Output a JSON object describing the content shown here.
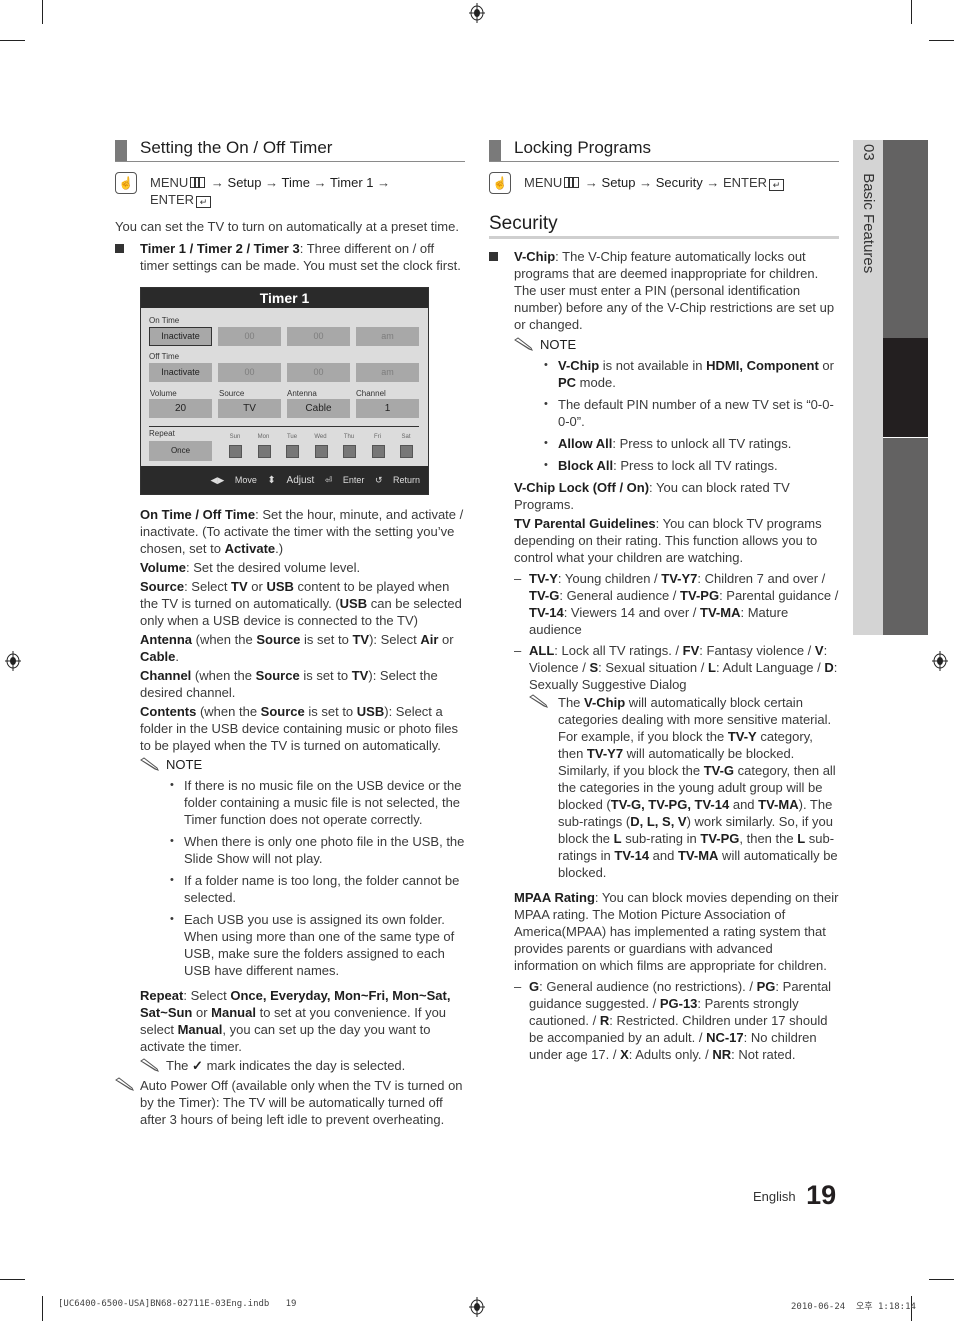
{
  "left": {
    "section_title": "Setting the On / Off Timer",
    "menu_path": {
      "menu": "MENU",
      "arrow1": "→",
      "setup": "Setup",
      "arrow2": "→",
      "time": "Time",
      "arrow3": "→",
      "timer": "Timer 1",
      "arrow4": "→",
      "enter": "ENTER"
    },
    "intro": "You can set the TV to turn on automatically at a preset time.",
    "timers_item": {
      "bold": "Timer 1 / Timer 2 / Timer 3",
      "text": ": Three different on / off timer settings can be made. You must set the clock first."
    },
    "timer_screen": {
      "title": "Timer 1",
      "on_time_label": "On Time",
      "on_time": [
        "Inactivate",
        "00",
        "00",
        "am"
      ],
      "off_time_label": "Off Time",
      "off_time": [
        "Inactivate",
        "00",
        "00",
        "am"
      ],
      "labels": [
        "Volume",
        "Source",
        "Antenna",
        "Channel"
      ],
      "values": [
        "20",
        "TV",
        "Cable",
        "1"
      ],
      "repeat_label": "Repeat",
      "repeat_value": "Once",
      "days": [
        "Sun",
        "Mon",
        "Tue",
        "Wed",
        "Thu",
        "Fri",
        "Sat"
      ],
      "footer": {
        "move": "Move",
        "adjust": "Adjust",
        "enter": "Enter",
        "return": "Return"
      }
    },
    "desc": [
      {
        "bold": "On Time / Off Time",
        "text": ": Set the hour, minute, and activate / inactivate. (To activate the timer with the setting you’ve chosen, set to ",
        "bold2": "Activate",
        "text2": ".)"
      },
      {
        "bold": "Volume",
        "text": ": Set the desired volume level."
      },
      {
        "bold": "Source",
        "text": ": Select ",
        "b_tv": "TV",
        "t_or": " or ",
        "b_usb": "USB",
        "t_rest": " content to be played when the TV is turned on automatically. (",
        "b_usb2": "USB",
        "t_end": " can be selected only when a USB device is connected to the TV)"
      },
      {
        "bold": "Antenna",
        "text": " (when the ",
        "b_src": "Source",
        "t2": " is set to ",
        "b_tv": "TV",
        "t3": "): Select ",
        "b_air": "Air",
        "t4": " or ",
        "b_cable": "Cable",
        "t5": "."
      },
      {
        "bold": "Channel",
        "text": " (when the ",
        "b_src": "Source",
        "t2": " is set to ",
        "b_tv": "TV",
        "t3": "): Select the desired channel."
      },
      {
        "bold": "Contents",
        "text": " (when the ",
        "b_src": "Source",
        "t2": " is set to ",
        "b_usb": "USB",
        "t3": "): Select a folder in the USB device containing music or photo files to be played when the TV is turned on automatically."
      }
    ],
    "note_label": "NOTE",
    "notes": [
      "If there is no music file on the USB device or the folder containing a music file is not selected, the Timer function does not operate correctly.",
      "When there is only one photo file in the USB, the Slide Show will not play.",
      "If a folder name is too long, the folder cannot be selected.",
      "Each USB you use is assigned its own folder. When using more than one of the same type of USB, make sure the folders assigned to each USB have different names."
    ],
    "repeat": {
      "bold": "Repeat",
      "t1": ": Select ",
      "b_opts": "Once, Everyday, Mon~Fri, Mon~Sat, Sat~Sun",
      "t2": " or ",
      "b_manual": "Manual",
      "t3": " to set at you convenience. If you select ",
      "b_manual2": "Manual",
      "t4": ", you can set up the day you want to activate the timer."
    },
    "check_note": {
      "pre": "The",
      "post": "mark indicates the day is selected."
    },
    "auto_power_off": "Auto Power Off (available only when the TV is turned on by the Timer): The TV will be automatically turned off after 3 hours of being left idle to prevent overheating."
  },
  "right": {
    "section_title": "Locking Programs",
    "menu_path": {
      "menu": "MENU",
      "arrow1": "→",
      "setup": "Setup",
      "arrow2": "→",
      "security": "Security",
      "arrow3": "→",
      "enter": "ENTER"
    },
    "subheading": "Security",
    "vchip": {
      "bold": "V-Chip",
      "text": ": The V-Chip feature automatically locks out programs that are deemed inappropriate for children. The user must enter a PIN (personal identification number) before any of the V-Chip restrictions are set up or changed."
    },
    "note_label": "NOTE",
    "notes": [
      {
        "b1": "V-Chip",
        "t1": " is not available in ",
        "b2": "HDMI, Component",
        "t2": " or ",
        "b3": "PC",
        "t3": " mode."
      },
      {
        "t1": "The default PIN number of a new TV set is “0-0-0-0”."
      },
      {
        "b1": "Allow All",
        "t1": ": Press to unlock all TV ratings."
      },
      {
        "b1": "Block All",
        "t1": ": Press to lock all TV ratings."
      }
    ],
    "vchip_lock": {
      "bold": "V-Chip Lock (Off / On)",
      "text": ": You can block rated TV Programs."
    },
    "tv_parental": {
      "bold": "TV Parental Guidelines",
      "text": ": You can block TV programs depending on their rating. This function allows you to control what your children are watching."
    },
    "ratings_dash": [
      {
        "b1": "TV-Y",
        "t1": ": Young children / ",
        "b2": "TV-Y7",
        "t2": ": Children 7 and over / ",
        "b3": "TV-G",
        "t3": ": General audience / ",
        "b4": "TV-PG",
        "t4": ": Parental guidance / ",
        "b5": "TV-14",
        "t5": ": Viewers 14 and over / ",
        "b6": "TV-MA",
        "t6": ": Mature audience"
      },
      {
        "b1": "ALL",
        "t1": ": Lock all TV ratings. / ",
        "b2": "FV",
        "t2": ": Fantasy violence / ",
        "b3": "V",
        "t3": ": Violence / ",
        "b4": "S",
        "t4": ": Sexual situation / ",
        "b5": "L",
        "t5": ": Adult Language / ",
        "b6": "D",
        "t6": ": Sexually Suggestive Dialog"
      }
    ],
    "auto_block_note": {
      "t0": "The ",
      "b1": "V-Chip",
      "t1": " will automatically block certain categories dealing with more sensitive material. For example, if you block the ",
      "b2": "TV-Y",
      "t2": " category, then ",
      "b3": "TV-Y7",
      "t3": " will automatically be blocked. Similarly, if you block the ",
      "b4": "TV-G",
      "t4": " category, then all the categories in the young adult group will be blocked (",
      "b5": "TV-G, TV-PG, TV-14",
      "t5": " and ",
      "b6": "TV-MA",
      "t6": "). The sub-ratings (",
      "b7": "D, L, S, V",
      "t7": ") work similarly. So, if you block the ",
      "b8": "L",
      "t8": " sub-rating in ",
      "b9": "TV-PG",
      "t9": ", then the ",
      "b10": "L",
      "t10": " sub-ratings in ",
      "b11": "TV-14",
      "t11": " and ",
      "b12": "TV-MA",
      "t12": " will automatically be blocked."
    },
    "mpaa": {
      "bold": "MPAA Rating",
      "text": ": You can block movies depending on their MPAA rating. The Motion Picture Association of America(MPAA) has implemented a rating system that provides parents or guardians with advanced information on which films are appropriate for children."
    },
    "mpaa_dash": {
      "b1": "G",
      "t1": ": General audience (no restrictions). / ",
      "b2": "PG",
      "t2": ": Parental guidance suggested. / ",
      "b3": "PG-13",
      "t3": ": Parents strongly cautioned. / ",
      "b4": "R",
      "t4": ": Restricted. Children under 17 should be accompanied by an adult. / ",
      "b5": "NC-17",
      "t5": ": No children under age 17. / ",
      "b6": "X",
      "t6": ": Adults only. / ",
      "b7": "NR",
      "t7": ": Not rated."
    }
  },
  "side_tab": {
    "chapter": "03",
    "title": "Basic Features"
  },
  "page_footer": {
    "language": "English",
    "page_number": "19"
  },
  "print_slug": {
    "file": "[UC6400-6500-USA]BN68-02711E-03Eng.indb   19",
    "date": "2010-06-24",
    "time": "오후 1:18:14"
  },
  "colors": {
    "tab_light": "#d4d4d4",
    "tab_dark": "#636262",
    "tab_active": "#231f20",
    "timer_title_bg": "#2a2a2a",
    "timer_body": "#dcdcdc"
  }
}
